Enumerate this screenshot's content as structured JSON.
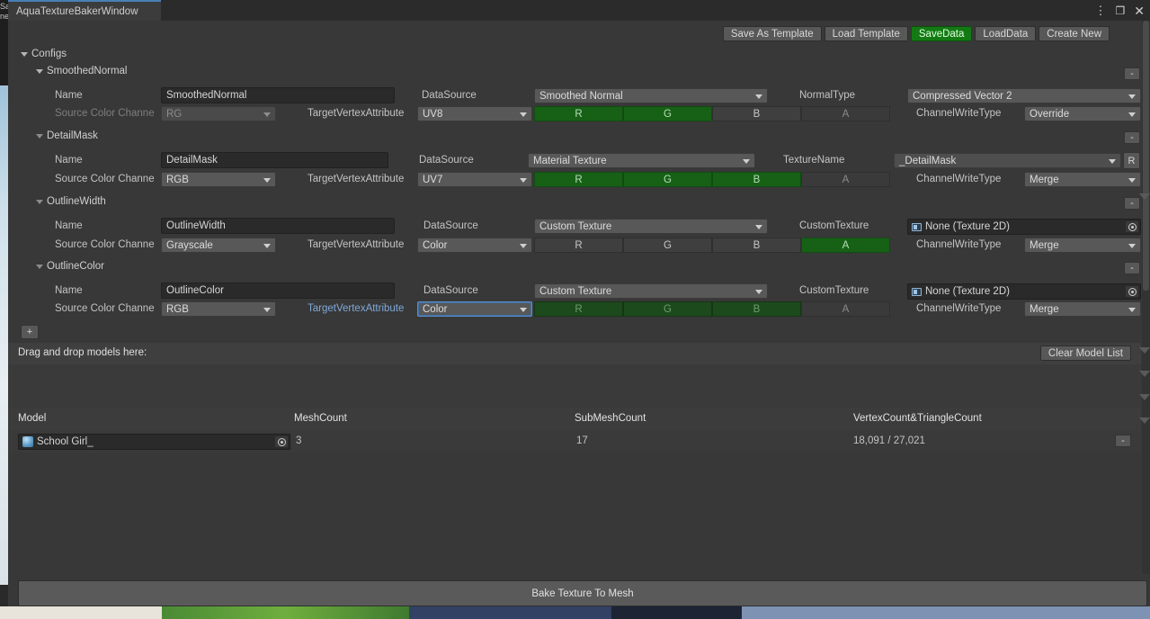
{
  "window": {
    "tab_title": "AquaTextureBakerWindow",
    "controls": {
      "menu": "⋮",
      "maximize": "❐",
      "close": "✕"
    },
    "behind_text": "Sa\nne"
  },
  "toolbar": {
    "buttons": [
      {
        "label": "Save As Template",
        "style": "normal"
      },
      {
        "label": "Load Template",
        "style": "normal"
      },
      {
        "label": "SaveData",
        "style": "green"
      },
      {
        "label": "LoadData",
        "style": "normal"
      },
      {
        "label": "Create New",
        "style": "normal"
      }
    ],
    "accent_green": "#137a13"
  },
  "configs": {
    "header": "Configs",
    "add_button": "+",
    "remove_button": "-",
    "labels": {
      "name": "Name",
      "data_source": "DataSource",
      "source_color_channel": "Source Color Channe",
      "target_vertex_attribute": "TargetVertexAttribute",
      "channel_write_type": "ChannelWriteType",
      "normal_type": "NormalType",
      "texture_name": "TextureName",
      "custom_texture": "CustomTexture"
    },
    "channels": {
      "r": "R",
      "g": "G",
      "b": "B",
      "a": "A"
    },
    "items": [
      {
        "title": "SmoothedNormal",
        "name_value": "SmoothedNormal",
        "data_source": "Smoothed Normal",
        "source_color_channel": "RG",
        "source_color_channel_disabled": true,
        "target_vertex_attribute": "UV8",
        "target_attr_focused": false,
        "third_label": "NormalType",
        "third_value": "Compressed Vector 2",
        "third_kind": "dropdown",
        "third_extra": "",
        "channel_write_type": "Override",
        "channel_states": [
          "on",
          "on",
          "off",
          "off"
        ]
      },
      {
        "title": "DetailMask",
        "name_value": "DetailMask",
        "data_source": "Material Texture",
        "source_color_channel": "RGB",
        "source_color_channel_disabled": false,
        "target_vertex_attribute": "UV7",
        "target_attr_focused": false,
        "third_label": "TextureName",
        "third_value": "_DetailMask",
        "third_kind": "dropdown",
        "third_extra": "R",
        "channel_write_type": "Merge",
        "channel_states": [
          "on",
          "on",
          "on",
          "off"
        ]
      },
      {
        "title": "OutlineWidth",
        "name_value": "OutlineWidth",
        "data_source": "Custom Texture",
        "source_color_channel": "Grayscale",
        "source_color_channel_disabled": false,
        "target_vertex_attribute": "Color",
        "target_attr_focused": false,
        "third_label": "CustomTexture",
        "third_value": "None (Texture 2D)",
        "third_kind": "object",
        "third_extra": "",
        "channel_write_type": "Merge",
        "channel_states": [
          "off",
          "off",
          "off",
          "on"
        ]
      },
      {
        "title": "OutlineColor",
        "name_value": "OutlineColor",
        "data_source": "Custom Texture",
        "source_color_channel": "RGB",
        "source_color_channel_disabled": false,
        "target_vertex_attribute": "Color",
        "target_attr_focused": true,
        "third_label": "CustomTexture",
        "third_value": "None (Texture 2D)",
        "third_kind": "object",
        "third_extra": "",
        "channel_write_type": "Merge",
        "channel_states": [
          "on-dim",
          "on-dim",
          "on-dim",
          "off-dim"
        ]
      }
    ]
  },
  "models": {
    "drag_label": "Drag and drop models here:",
    "clear_button": "Clear Model List",
    "remove_button": "-",
    "columns": [
      "Model",
      "MeshCount",
      "SubMeshCount",
      "VertexCount&TriangleCount"
    ],
    "rows": [
      {
        "model": "School Girl_",
        "mesh_count": "3",
        "sub_mesh_count": "17",
        "vertex_triangle_count": "18,091 / 27,021"
      }
    ]
  },
  "footer": {
    "bake_button": "Bake Texture To Mesh"
  }
}
